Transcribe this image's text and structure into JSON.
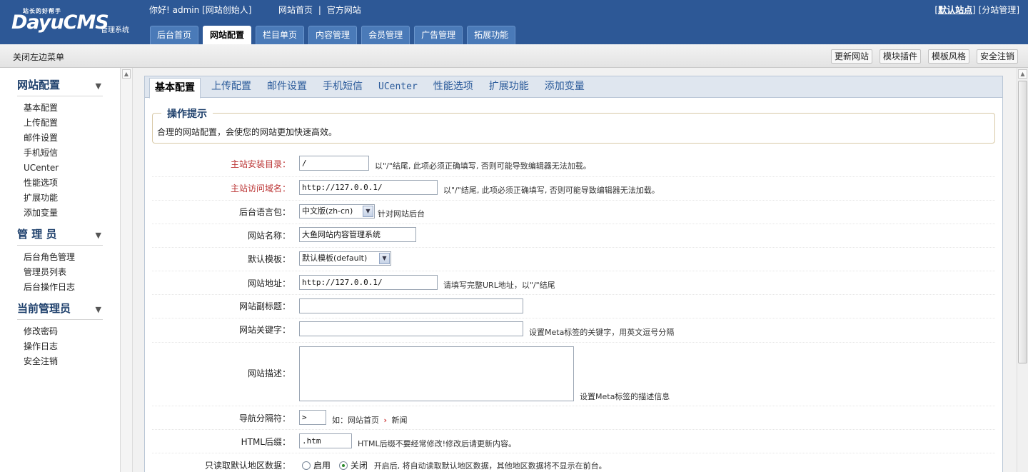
{
  "header": {
    "logo_tag": "站长的好帮手",
    "logo_main": "DayuCMS",
    "logo_sub": "管理系统",
    "greeting": "你好! admin [网站创始人]",
    "links": [
      "网站首页",
      "官方网站"
    ],
    "link_sep": "|",
    "right_open": "[",
    "right_current": "默认站点",
    "right_mid": "] [",
    "right_manage": "分站管理",
    "right_close": "]",
    "nav": [
      "后台首页",
      "网站配置",
      "栏目单页",
      "内容管理",
      "会员管理",
      "广告管理",
      "拓展功能"
    ],
    "nav_active": "网站配置"
  },
  "subbar": {
    "close_menu": "关闭左边菜单",
    "buttons": [
      "更新网站",
      "模块插件",
      "模板风格",
      "安全注销"
    ]
  },
  "sidebar": {
    "groups": [
      {
        "title": "网站配置",
        "items": [
          "基本配置",
          "上传配置",
          "邮件设置",
          "手机短信",
          "UCenter",
          "性能选项",
          "扩展功能",
          "添加变量"
        ]
      },
      {
        "title": "管 理 员",
        "items": [
          "后台角色管理",
          "管理员列表",
          "后台操作日志"
        ]
      },
      {
        "title": "当前管理员",
        "items": [
          "修改密码",
          "操作日志",
          "安全注销"
        ]
      }
    ],
    "arrow": "▼"
  },
  "tabs": [
    "基本配置",
    "上传配置",
    "邮件设置",
    "手机短信",
    "UCenter",
    "性能选项",
    "扩展功能",
    "添加变量"
  ],
  "tabs_active": "基本配置",
  "tip": {
    "title": "操作提示",
    "text": "合理的网站配置，会使您的网站更加快速高效。"
  },
  "form": {
    "install_dir": {
      "label": "主站安装目录：",
      "value": "/",
      "hint": "以\"/\"结尾, 此项必须正确填写, 否则可能导致编辑器无法加载。"
    },
    "domain": {
      "label": "主站访问域名：",
      "value": "http://127.0.0.1/",
      "hint": "以\"/\"结尾, 此项必须正确填写, 否则可能导致编辑器无法加载。"
    },
    "lang": {
      "label": "后台语言包：",
      "value": "中文版(zh-cn)",
      "hint": "针对网站后台"
    },
    "site_name": {
      "label": "网站名称：",
      "value": "大鱼网站内容管理系统"
    },
    "template": {
      "label": "默认模板：",
      "value": "默认模板(default)"
    },
    "site_url": {
      "label": "网站地址：",
      "value": "http://127.0.0.1/",
      "hint": "请填写完整URL地址，以\"/\"结尾"
    },
    "subtitle": {
      "label": "网站副标题：",
      "value": ""
    },
    "keywords": {
      "label": "网站关键字：",
      "value": "",
      "hint": "设置Meta标签的关键字，用英文逗号分隔"
    },
    "description": {
      "label": "网站描述：",
      "hint": "设置Meta标签的描述信息"
    },
    "nav_sep": {
      "label": "导航分隔符：",
      "value": ">",
      "hint_prefix": "如：网站首页",
      "hint_arrow": "›",
      "hint_suffix": "新闻"
    },
    "html_ext": {
      "label": "HTML后缀：",
      "value": ".htm",
      "hint": "HTML后缀不要经常修改!修改后请更新内容。"
    },
    "region": {
      "label": "只读取默认地区数据：",
      "opt_on": "启用",
      "opt_off": "关闭",
      "hint": "开启后, 将自动读取默认地区数据，其他地区数据将不显示在前台。"
    }
  },
  "scroll_up": "▲",
  "colors": {
    "header_bg": "#2d5896",
    "accent": "#1d3f6b",
    "required_label": "#b33333"
  }
}
